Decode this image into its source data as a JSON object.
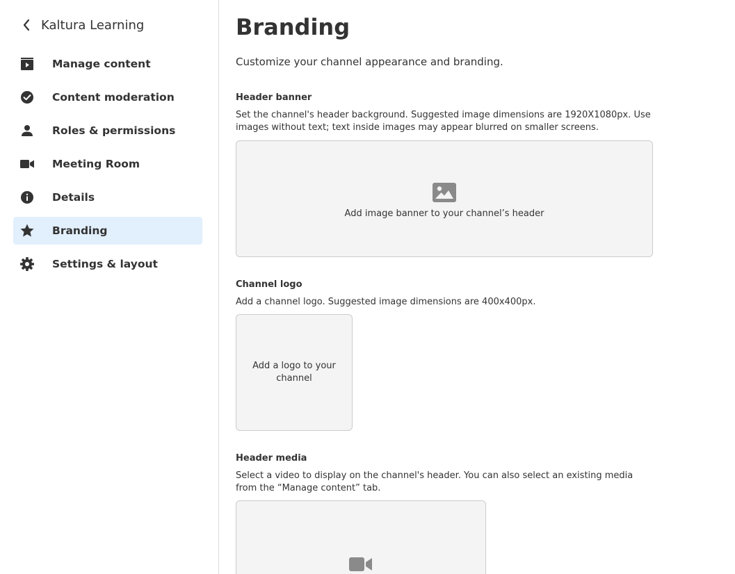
{
  "sidebar": {
    "back_title": "Kaltura Learning",
    "items": [
      {
        "label": "Manage content",
        "icon": "video-library-icon",
        "active": false
      },
      {
        "label": "Content moderation",
        "icon": "check-circle-icon",
        "active": false
      },
      {
        "label": "Roles & permissions",
        "icon": "person-icon",
        "active": false
      },
      {
        "label": "Meeting Room",
        "icon": "video-camera-icon",
        "active": false
      },
      {
        "label": "Details",
        "icon": "info-icon",
        "active": false
      },
      {
        "label": "Branding",
        "icon": "star-icon",
        "active": true
      },
      {
        "label": "Settings & layout",
        "icon": "gear-icon",
        "active": false
      }
    ]
  },
  "main": {
    "title": "Branding",
    "subtitle": "Customize your channel appearance and branding.",
    "header_banner": {
      "title": "Header banner",
      "description": "Set the channel's header background. Suggested image dimensions are 1920X1080px. Use images without text; text inside images may appear blurred on smaller screens.",
      "dropzone_text": "Add image banner to your channel’s header",
      "icon": "image-icon"
    },
    "channel_logo": {
      "title": "Channel logo",
      "description": "Add a channel logo. Suggested image dimensions are 400x400px.",
      "dropzone_text": "Add a logo to your channel"
    },
    "header_media": {
      "title": "Header media",
      "description": "Select a video to display on the channel's header. You can also select an existing media from the “Manage content” tab.",
      "icon": "video-camera-icon"
    }
  },
  "colors": {
    "active_bg": "#e2effc",
    "dropzone_bg": "#f4f4f4",
    "icon_gray": "#8a8a8a",
    "text": "#333333"
  }
}
